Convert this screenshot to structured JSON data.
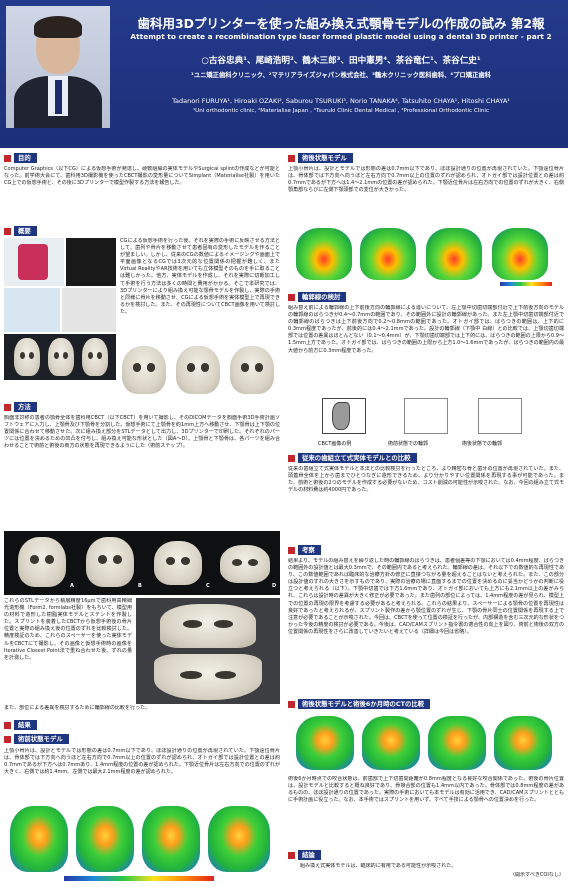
{
  "header": {
    "title_ja": "歯科用3Dプリンターを使った組み換え式顎骨モデルの作成の試み 第2報",
    "title_en": "Attempt to create a recombination type laser formed plastic model using a dental 3D printer - part 2",
    "authors_ja": "○古谷忠典¹、尾崎浩明²、鶴木三郎³、田中憲男⁴、茶谷竜仁¹、茶谷仁史¹",
    "affiliations_ja": "¹ユニ矯正歯科クリニック、²マテリアライズジャパン株式会社、³鶴木クリニック医科歯科、⁴プロ矯正歯科",
    "authors_en": "Tadanori FURUYA¹, Hiroaki OZAKI², Saburou TSURUKI³, Norio TANAKA⁴, Tatsuhito CHAYA¹, Hitoshi CHAYA¹",
    "affiliations_en": "¹Uni orthodontic clinic, ²Materialise Japan , ³Tsuruki Clinic Dental Medical , ⁴Professional Orthodontic Clinic"
  },
  "sections": {
    "purpose": {
      "heading": "目的",
      "body": "Computer Graphics（以下CG）による仮想手術が発達し、硬軟組織の実体モデルやSurgical splintの作成などが可能となった。前学術大会にて、歯科用3D撮影機を使ったCBCT撮影の変形量についてSimplant（Materialise社製）を用いたCG上での仮想手術と、その後に3Dプリンターで模型作製する方法を報告した。"
    },
    "summary": {
      "heading": "概要",
      "body": "CGによる仮想手術を行った後、それを実際の手術に反映させる方法として、歯列や骨片を移動させて患者固有の変形したモデルを作ることが望ましい。しかし、従来のCGの数値によるイメージングや画面上で平面画像となるCGでは3次元的な位置関係の把握が難しく、またVirtual RealityやAR技術を用いても立体模型そのものを手に取ることは難しかった。他方、実体モデルを作成し、それを実際に切断加工して手術を行う方法は多くの時間と費用がかかる。そこで本研究では、3Dプリンターにより組み換え可能な顎骨モデルを作製し、実際の手術と同様に骨片を移動させ、CGによる仮想手術を実体模型上で再現できるかを検討した。また、その再現性についてCBCT画像を用いて検討した。"
    },
    "method": {
      "heading": "方法",
      "body": "顔面非対称の患者の顎骨全体を歯科用CBCT（以下CBCT）を用いて撮影し、そのDICOMデータを顔面手術3D手術計画ソフトウェアに入力し、上顎骨及び下顎骨を分割した。仮想手術にて上顎骨を約1mm上方へ移動させ、下顎骨は上下顎の位置関係に合わせて移動させた。次に組み換え部分をSTLデータとして出力し、3Dプリンターで印刷した。それぞれのパーツには位置を決めるための凹凸を付与し、組み換え可能な形状とした（図A〜D）。上顎骨と下顎骨は、各パーツを組み合わせることで術前と術後の両方の状態を再現できるようにした（術前ステップ）。",
      "figure_labels": [
        "A",
        "B",
        "C",
        "D"
      ],
      "body2": "これらのSTLデータから積層精度16μmで歯科用高精細光造形機（Form2, formlabs社製）をもちいて、模型用の材料で造形した樹脂実体モデルとステントを作製した。スプリントを装着したCBCTから仮想手術後の骨片位置と実際の組み換え後の位置のずれを比較検討した。精度検証のため、これらのスペーサーを使った実体モデルをCBCTにて撮影し、その画像と仮想手術時の画像をIterative Closest Point法で重ね合わせた後、ずれの量を計測した。",
      "body3": "また、部位による差異を検討するために輪郭線の比較を行った。"
    },
    "results": {
      "heading": "結果",
      "sub_heading": "術前状態モデル",
      "body": "上顎小骨片は、設計とモデルでは形態の差は0.7mm以下であり、ほぼ設計通りの位置が再現されていた。下顎遠位骨片は、骨体部では下方向へ向うほど左右方向で0.7mm以上の位置のずれが認められ、オトガイ部では設計位置との差は約0.7mmであるが下方へは0.7mmあり、1.4mm程度の位置の差が認められた。下顎近位骨片は左右方向での位置のずれが大きく、右側では約1.4mm、左側では最大2.1mm程度の差が認められた。"
    },
    "post": {
      "heading": "術後状態モデル",
      "body": "上顎小骨片は、設計とモデルでは形態の差は0.7mm以下であり、ほぼ設計通りの位置が再現されていた。下顎遠位骨片は、骨体部では下方向へ向うほど左右方向で0.7mm以上の位置のずれが認められ、オトガイ部では設計位置との差は約0.7mmであるが下方へは1.4〜2.1mmの位置の差が認められた。下顎近位骨片は左右方向での位置のずれが大きく、右側顎角部ならびに左側下顎頭部での変位が大きかった。"
    },
    "contour": {
      "heading": "輪郭線の検討",
      "body": "組み替え前による輪郭線の上下前後方向の輪郭線による違いについて、左上顎中切歯切端部付近で上下前後方向のモデルの輪郭線のばらつきが0.4〜0.7mmの範囲であり、その範囲外に設計の輪郭線があった。また左上顎中切歯切端部付近での輪郭線のばらつきは上下前後方向で0.2〜0.8mmの範囲であった。オトガイ部では、ばらつきの範囲は、上下的に0.3mm程度であったが、前後的には0.4〜2.1mmであった。設計の輪郭線（下顎中 白線）との比較では、上顎切歯切端部では位置の差異はほとんどない（0.1〜0.4mm）が、下顎切歯切端部では上下的には、ばらつきの範囲の上限から0.9〜1.5mm上方であった。オトガイ部では、ばらつきの範囲の上限から上方1.0〜1.6mmであったが、ばらつきの範囲内の最大値から前方に0.3mm程度であった。",
      "figure_captions": [
        "CBCT画像の例",
        "術前状態での輪郭",
        "術後状態での輪郭"
      ]
    },
    "comparison": {
      "heading": "従来の歯組立て式実体モデルとの比較",
      "body": "従来の歯組立て式実体モデルと本法との比較検討を行ったところ、より精密な骨と歯牙の位置が再現されていた。また、頭蓋骨全体を上から歯までひとつなぎに造形できるため、より分かりやすい位置関係を再現する事が可能であった。また、前術と術後の2つのモデルを作成する必要がないため、コスト削減の可能性が示唆された。なお、今回の組み立て式モデルの材料費は約4000円であった。"
    },
    "discussion": {
      "heading": "考察",
      "body": "結果より、モデルの組み替えを繰り返した時の輪郭線のばらつきは、患者個差等の下顎においては0.4mm程度、ばらつきの範囲外の設計値とは最大0.3mmで、その範囲内であると考えられた。輪郭線の差は、それ以下での数値的な再現性であり、この数値範囲であれば臨床的な治療方針の修正に直接つながる量を超えることはないと考えられた。また、この部分は設計値のずれの大きさを示すものであり、実際の治療の場に直面するまでの位置を決めるのに妥当かどうかの判断に役立つと考えられる（以下）。下顎中切歯では下方1.6mmであり、オトガイ部においても上方にも2.1mm以上の差がみられ、これらは設計時の差異が大きく修正が必要であった。また歯列の部位によっては、1.4mm程度の差が見られ、模型上での位置の再現の限界を考慮する必要があると考えられる。これらの結果より、スペーサーによる顎骨の位置を再現性は良好であったと考えられるが、スプリント製作の差から顎位置のずれが生じ、下顎の骨片同士の位置関係を再現する上で注意が必要であることが示唆された。今回は、CBCTを使って位置の検証を行ったが、内部構造を含む三次元的な形状をつかった今後の精度の検討が必要である。今後は、CAD/CAMスプリント指令書の適合性の向上を図り、術前と術後の双方の位置関係の再現性をさらに改善していきたいと考えている（詳細は今回は省略）。"
    },
    "cbct": {
      "heading": "術後状態モデルと術後6か月時のCTの比較",
      "body": "術後6か月時点での咬合状態は、前歯部で上下切歯間距離が0.8mm程度となる良好な咬合関係であった。術後の骨片位置は、設計モデルと比較すると概ね良好であり、骨接合部の位置も1.4mm以内であった。骨体部では0.8mm程度の差があるものの、ほぼ設計通りの位置であった。実際の手術においても本モデルは有効に活用でき、CAD/CAMスプリントとともに手術計画に役立った。なお、本手術ではスプリントを用いず、すべて手技による顎骨への位置決めを行った。"
    },
    "conclusion": {
      "heading": "結論",
      "body": "組み換え式実体モデルは、臨床的に有用である可能性が示唆された。",
      "note": "（開示すべきCOIなし）"
    }
  }
}
